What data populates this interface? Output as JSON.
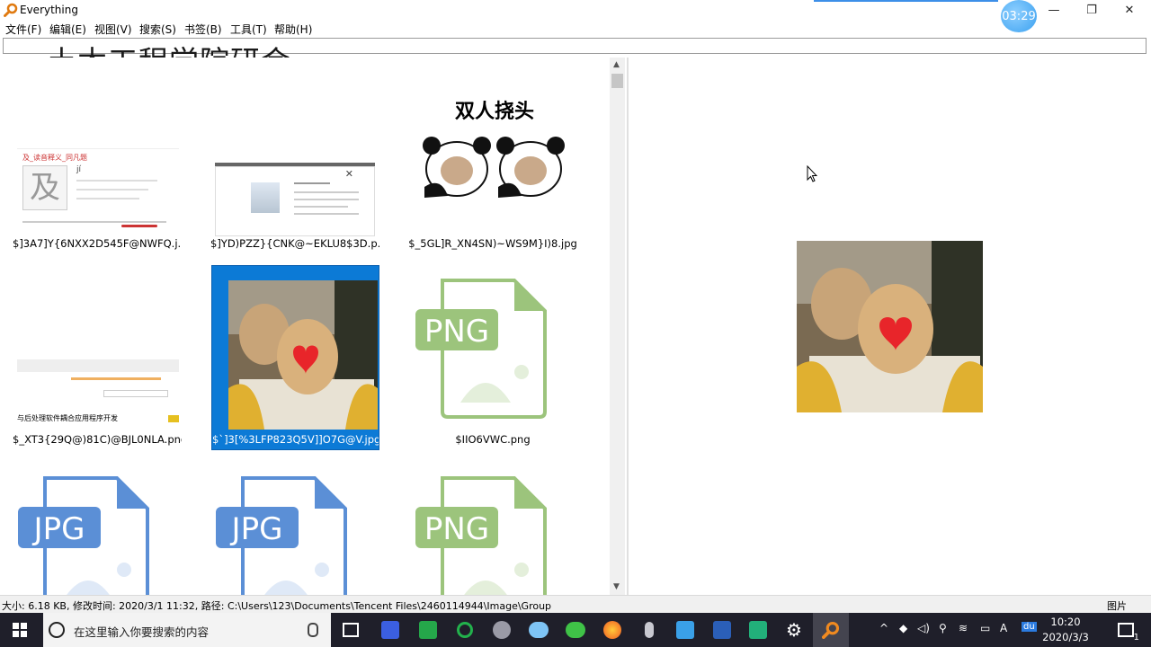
{
  "window": {
    "title": "Everything",
    "timer": "03:29",
    "controls": {
      "minimize": "—",
      "maximize": "❐",
      "close": "✕"
    },
    "accent": "#e8252a"
  },
  "menu": [
    "文件(F)",
    "编辑(E)",
    "视图(V)",
    "搜索(S)",
    "书签(B)",
    "工具(T)",
    "帮助(H)"
  ],
  "search": {
    "value": "",
    "placeholder": ""
  },
  "watermark": "土木工程学院研会",
  "thumbs": [
    {
      "name": "$]3A7]Y{6NXX2D545F@NWFQ.j...",
      "kind": "doc-screenshot",
      "doc_title": "及_读音释义_同凡题",
      "doc_char": "及",
      "doc_pinyin": "jí"
    },
    {
      "name": "$]YD)PZZ}{CNK@~EKLU8$3D.p...",
      "kind": "dialog-screenshot"
    },
    {
      "name": "$_5GL]R_XN4SN)~WS9M}I)8.jpg",
      "kind": "meme",
      "caption": "双人挠头"
    },
    {
      "name": "$_XT3{29Q@)81C)@BJL0NLA.png",
      "kind": "web-screenshot",
      "web_text": "与后处理软件耦合应用程序开发"
    },
    {
      "name": "$`]3[%3LFP823Q5V]]O7G@V.jpg",
      "kind": "photo-heart",
      "selected": true
    },
    {
      "name": "$IIO6VWC.png",
      "kind": "png-icon",
      "icon_label": "PNG"
    },
    {
      "name": "",
      "kind": "jpg-icon",
      "icon_label": "JPG"
    },
    {
      "name": "",
      "kind": "jpg-icon",
      "icon_label": "JPG"
    },
    {
      "name": "",
      "kind": "png-icon",
      "icon_label": "PNG"
    }
  ],
  "status": {
    "text": "大小: 6.18 KB, 修改时间: 2020/3/1 11:32, 路径: C:\\Users\\123\\Documents\\Tencent Files\\2460114944\\Image\\Group",
    "right": "图片"
  },
  "taskbar": {
    "search_placeholder": "在这里输入你要搜索的内容",
    "time": "10:20",
    "date": "2020/3/3",
    "ime": "A",
    "notifications": "1",
    "baidu": "du"
  },
  "colors": {
    "selection": "#0c7ad6",
    "jpg_icon": "#5b8fd6",
    "png_icon": "#9cc47c"
  }
}
